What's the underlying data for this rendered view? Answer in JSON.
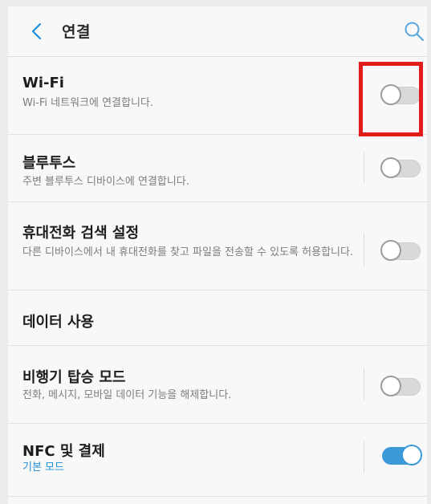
{
  "header": {
    "title": "연결",
    "back_icon": "chevron-left-icon",
    "search_icon": "search-icon"
  },
  "colors": {
    "accent": "#3d9ad8",
    "highlight": "#e21b1b",
    "link_blue": "#1f8fd6"
  },
  "settings": [
    {
      "title": "Wi-Fi",
      "subtitle": "Wi-Fi 네트워크에 연결합니다.",
      "toggle": "off"
    },
    {
      "title": "블루투스",
      "subtitle": "주변 블루투스 디바이스에 연결합니다.",
      "toggle": "off"
    },
    {
      "title": "휴대전화 검색 설정",
      "subtitle": "다른 디바이스에서 내 휴대전화를 찾고 파일을 전송할 수 있도록 허용합니다.",
      "toggle": "off"
    },
    {
      "title": "데이터 사용"
    },
    {
      "title": "비행기 탑승 모드",
      "subtitle": "전화, 메시지, 모바일 데이터 기능을 해제합니다.",
      "toggle": "off"
    },
    {
      "title": "NFC 및 결제",
      "subtitle": "기본 모드",
      "toggle": "on"
    }
  ]
}
